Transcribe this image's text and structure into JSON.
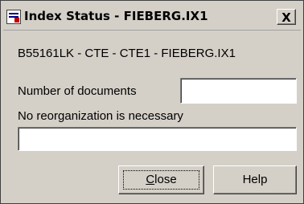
{
  "window": {
    "title": "Index Status - FIEBERG.IX1",
    "close_glyph": "X"
  },
  "index_path": "B55161LK - CTE - CTE1 - FIEBERG.IX1",
  "documents": {
    "label": "Number of documents",
    "value": ""
  },
  "status": {
    "label": "No reorganization is necessary",
    "value": ""
  },
  "buttons": {
    "close_mnemonic": "C",
    "close_rest": "lose",
    "help": "Help"
  },
  "icons": {
    "app": "index-status-app-icon"
  }
}
